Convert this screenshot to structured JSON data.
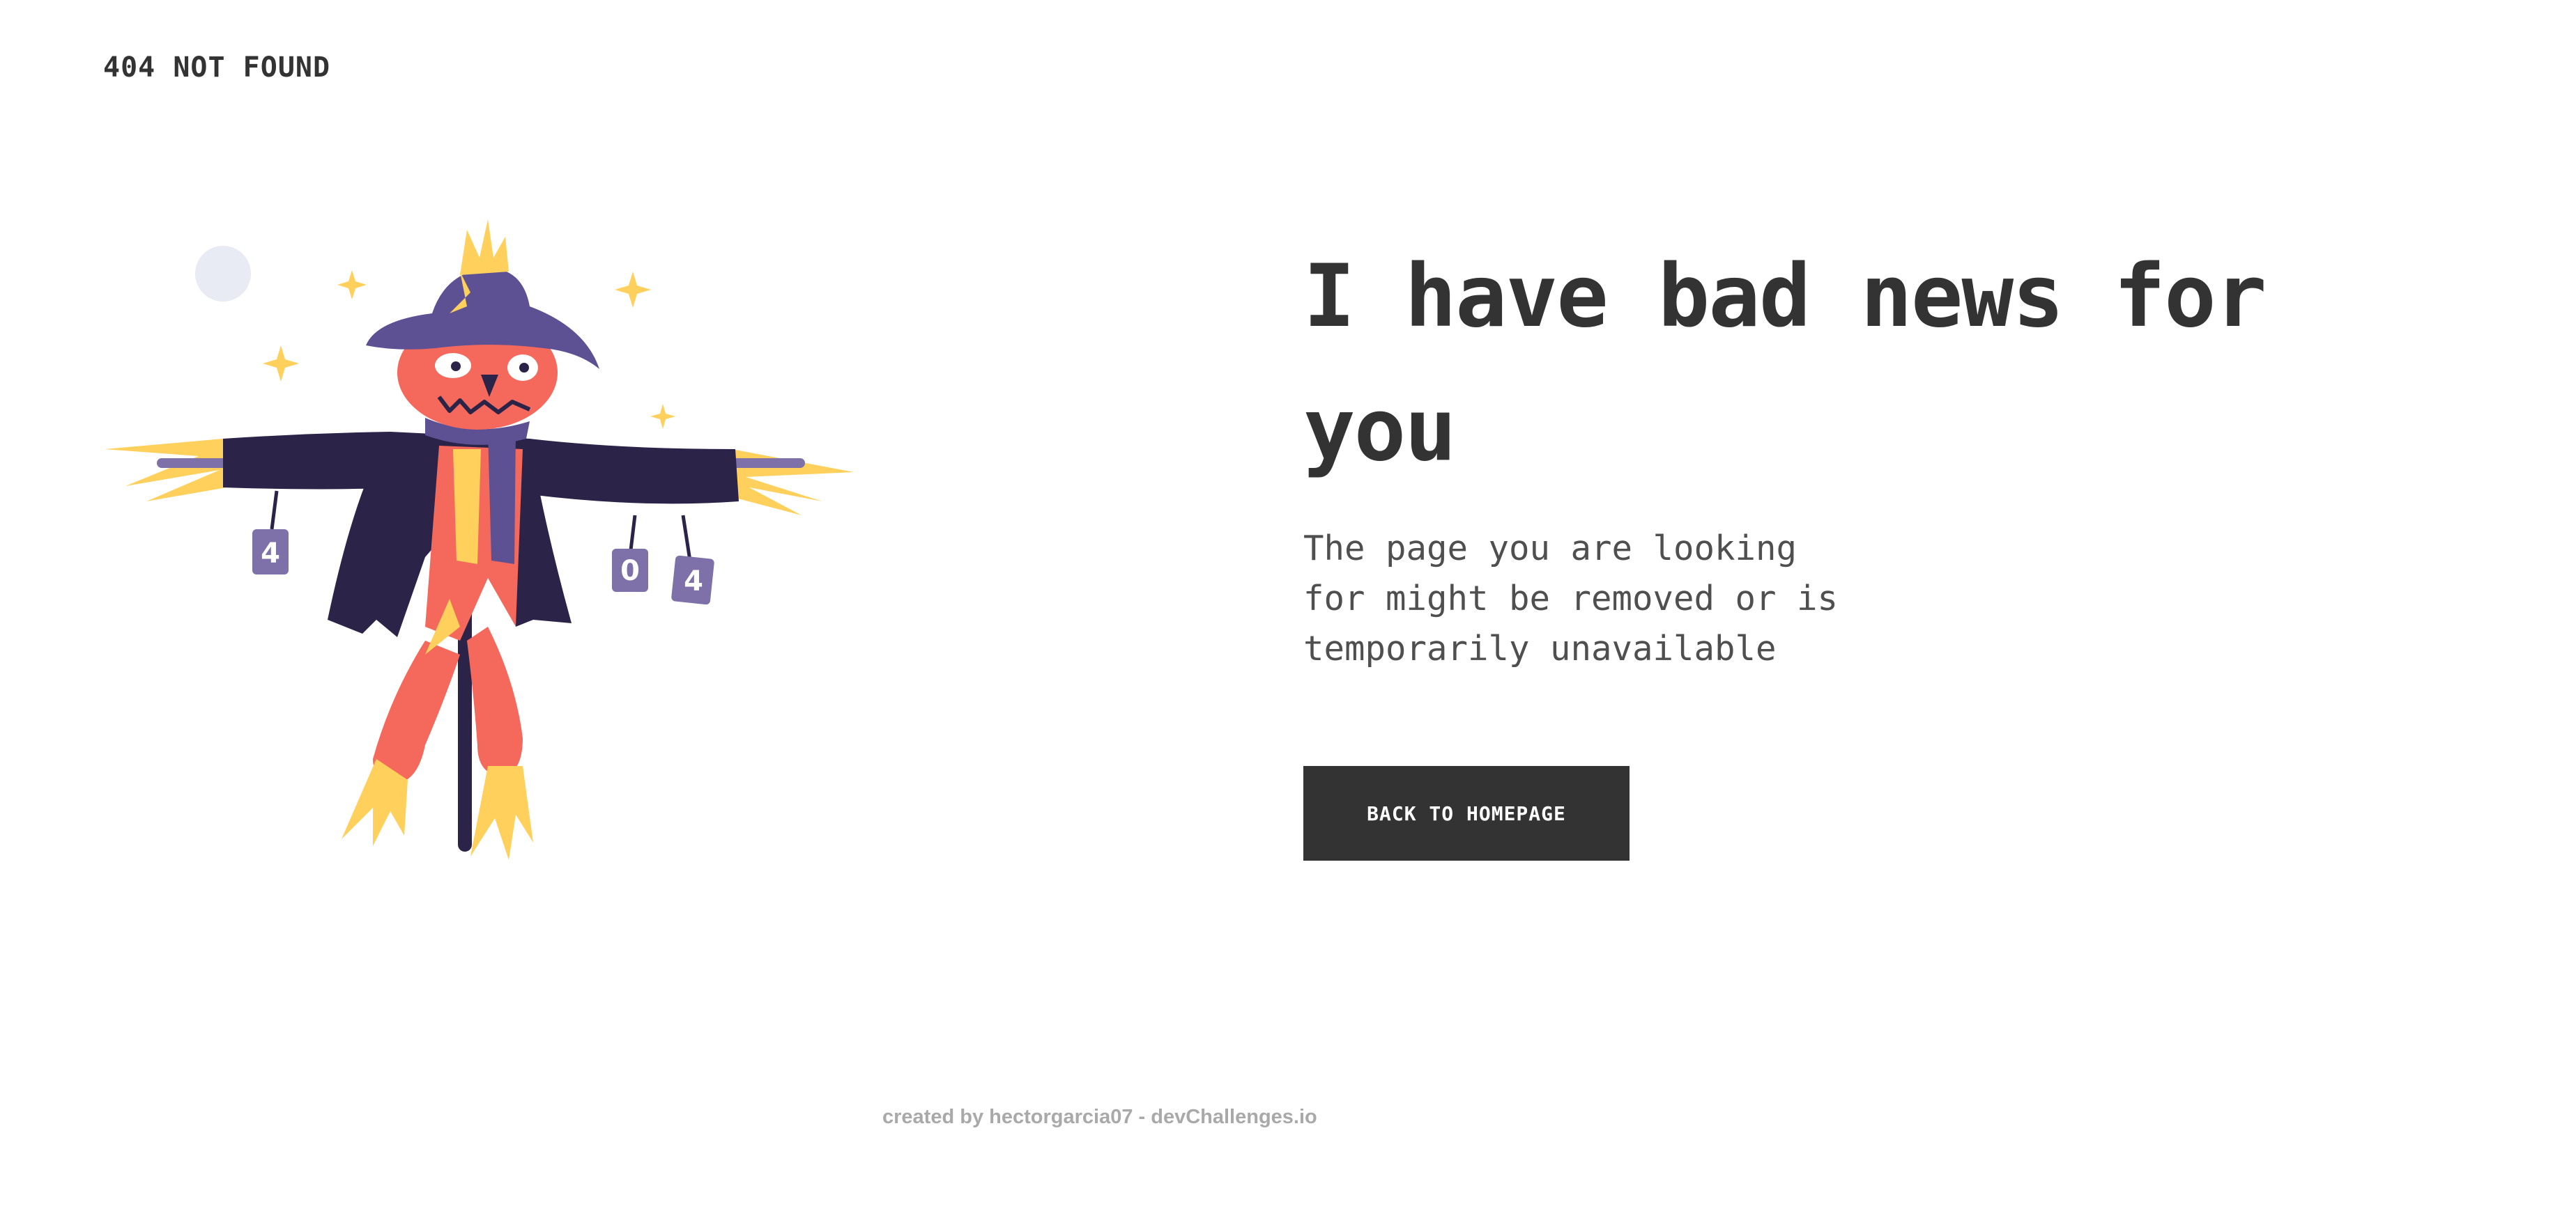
{
  "header": {
    "brand": "404 NOT FOUND"
  },
  "main": {
    "headline": "I have bad news for you",
    "message": "The page you are looking for might be removed or is temporarily unavailable",
    "back_button_label": "BACK TO HOMEPAGE"
  },
  "illustration": {
    "can_labels": [
      "4",
      "0",
      "4"
    ]
  },
  "footer": {
    "credit": "created by hectorgarcia07 - devChallenges.io"
  },
  "colors": {
    "text": "#333333",
    "button_bg": "#333333",
    "button_text": "#ffffff",
    "footer_text": "#a9a9a9",
    "straw": "#ffd05b",
    "hat": "#5d5194",
    "coat": "#2b2448",
    "face": "#f4695b",
    "can": "#7e70a8",
    "moon": "#e8eaf4"
  }
}
